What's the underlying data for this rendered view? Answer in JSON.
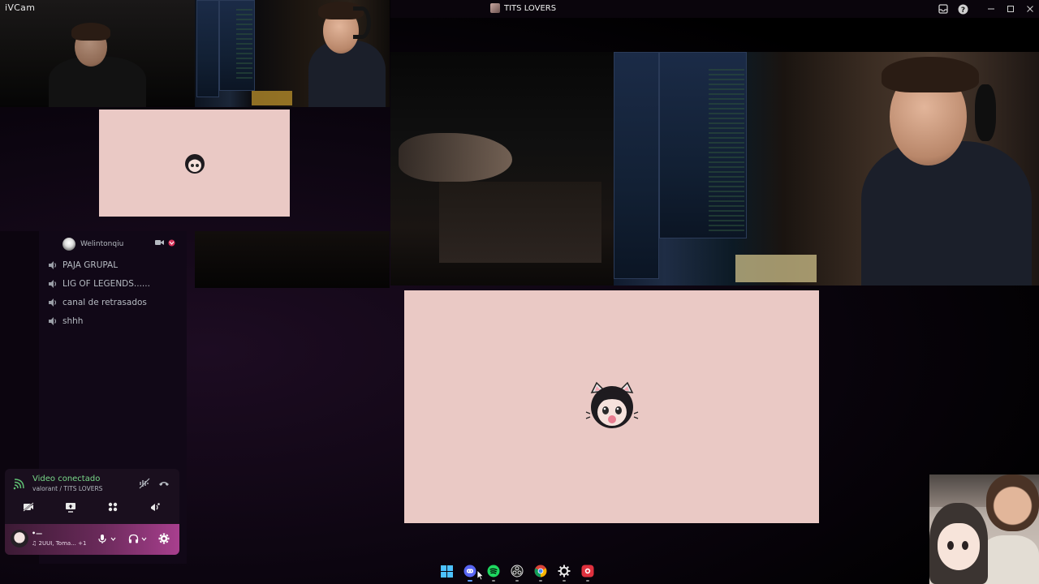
{
  "app": {
    "name": "iVCam"
  },
  "window": {
    "title": "TITS LOVERS",
    "icons": [
      "inbox-icon",
      "help-icon",
      "minimize-icon",
      "maximize-icon",
      "close-icon"
    ]
  },
  "video_tiles": [
    {
      "type": "camera",
      "label": "camera-feed-1"
    },
    {
      "type": "camera",
      "label": "camera-feed-2"
    },
    {
      "type": "camera",
      "label": "camera-feed-3"
    },
    {
      "type": "camera",
      "label": "camera-feed-4"
    },
    {
      "type": "avatar",
      "background": "#eac9c5"
    },
    {
      "type": "avatar",
      "background": "#eac9c5"
    }
  ],
  "channels": {
    "connected_user": "Welintonqiu",
    "items": [
      {
        "label": "PAJA GRUPAL"
      },
      {
        "label": "LIG OF LEGENDS......"
      },
      {
        "label": "canal de retrasados"
      },
      {
        "label": "shhh"
      }
    ]
  },
  "voice": {
    "status": "Video conectado",
    "channel": "valorant / TITS LOVERS",
    "status_color": "#79d98a"
  },
  "user": {
    "name": "•—",
    "activity": "♫ 2UUI, Toma...  +1"
  },
  "taskbar": {
    "apps": [
      "windows-start-icon",
      "discord-icon",
      "spotify-icon",
      "obs-icon",
      "chrome-icon",
      "steelseries-icon",
      "recorder-icon"
    ]
  },
  "colors": {
    "accent": "#a83f8e",
    "tile_bg": "#eac9c5",
    "taskbar_active": "#5e9bff"
  }
}
